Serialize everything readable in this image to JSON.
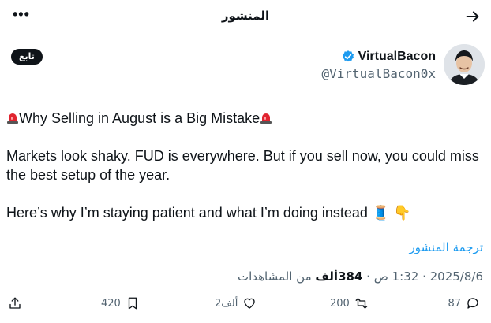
{
  "header": {
    "title": "المنشور",
    "more_icon": "more-horizontal-icon",
    "back_icon": "arrow-right-icon"
  },
  "author": {
    "name": "VirtualBacon",
    "handle": "@VirtualBacon0x",
    "verified_icon": "verified-badge-icon",
    "follow_label": "تابع",
    "verified_color": "#1d9bf0"
  },
  "post": {
    "title_line": "Why Selling in August is a Big Mistake",
    "paragraph1": "Markets look shaky. FUD is everywhere. But if you sell now, you could miss the best setup of the year.",
    "paragraph2": "Here’s why I’m staying patient and what I’m doing instead",
    "emoji_end": "🧵 👇"
  },
  "translate_label": "ترجمة المنشور",
  "meta": {
    "date": "2025/8/6",
    "time": "1:32 ص",
    "views_count": "384ألف",
    "views_label": "من المشاهدات"
  },
  "actions": {
    "replies": "87",
    "reposts": "200",
    "likes": "2ألف",
    "bookmarks": "420"
  },
  "colors": {
    "accent": "#1d9bf0",
    "text": "#0f1419",
    "muted": "#536471"
  }
}
